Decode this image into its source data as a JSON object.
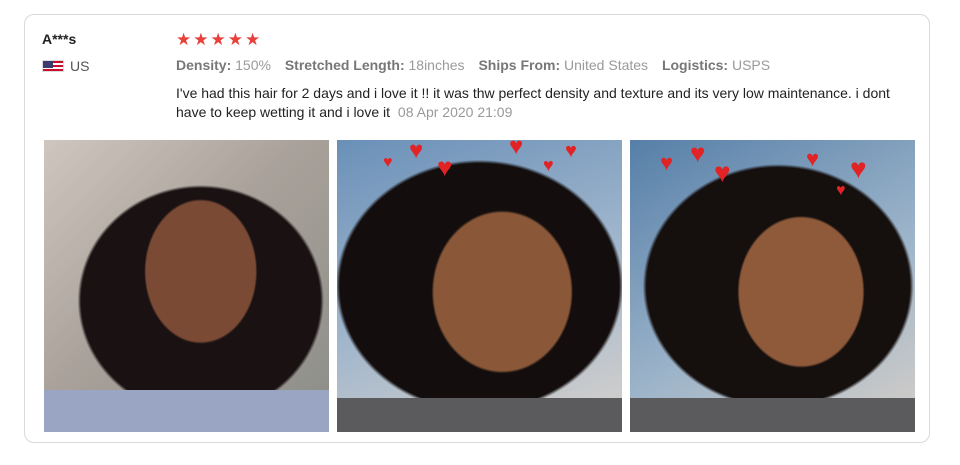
{
  "review": {
    "user_name": "A***s",
    "country": "US",
    "rating": 5,
    "stars": [
      "★",
      "★",
      "★",
      "★",
      "★"
    ],
    "attributes": [
      {
        "label": "Density:",
        "value": "150%"
      },
      {
        "label": "Stretched Length:",
        "value": "18inches"
      },
      {
        "label": "Ships From:",
        "value": "United States"
      },
      {
        "label": "Logistics:",
        "value": "USPS"
      }
    ],
    "text": "I've had this hair for 2 days and i love it !! it was thw perfect density and texture and its very low maintenance. i dont have to keep wetting it and i love it",
    "date": "08 Apr 2020 21:09"
  },
  "photos": [
    {
      "icon": "customer-photo-1"
    },
    {
      "icon": "customer-photo-2"
    },
    {
      "icon": "customer-photo-3"
    }
  ],
  "colors": {
    "star": "#e8403a",
    "heart": "#e12326",
    "border": "#d9d9d9"
  }
}
